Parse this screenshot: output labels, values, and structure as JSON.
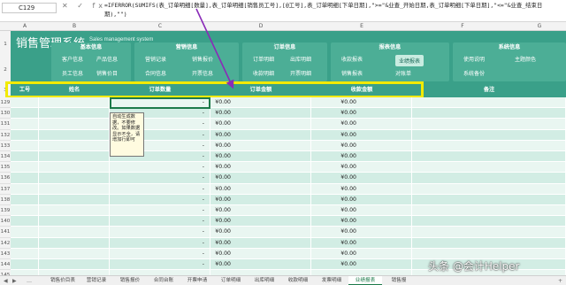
{
  "formula_bar": {
    "name_box": "C129",
    "icons": "✕ ✓ fx",
    "formula": "=IFERROR(SUMIFS(表_订单明细[数量],表_订单明细[销售员工号],[@工号],表_订单明细[下单日期],\">=\"&业查_开始日期,表_订单明细[下单日期],\"<=\"&业查_结束日期),\"\")"
  },
  "columns": [
    "A",
    "B",
    "C",
    "D",
    "E",
    "F",
    "G",
    "H"
  ],
  "banner": {
    "title": "销售管理系统",
    "subtitle": "Sales management system",
    "groups": [
      {
        "title": "基本信息",
        "buttons": [
          "客户信息",
          "产品信息",
          "员工信息",
          "销售价目"
        ]
      },
      {
        "title": "营销信息",
        "buttons": [
          "营销记录",
          "销售报价",
          "合同信息",
          "开票信息"
        ]
      },
      {
        "title": "订单信息",
        "buttons": [
          "订单明细",
          "出库明细",
          "收款明细",
          "开票明细"
        ]
      },
      {
        "title": "报表信息",
        "buttons": [
          "收款报表",
          "业绩报表",
          "销售报表",
          "对账单"
        ]
      },
      {
        "title": "系统信息",
        "buttons": [
          "使用说明",
          "主题颜色",
          "系统备份"
        ]
      }
    ]
  },
  "row_numbers_top": [
    "1",
    "2"
  ],
  "table_header": {
    "row": "3",
    "id": "工号",
    "name": "姓名",
    "qty": "订单数量",
    "amount": "订单金额",
    "received": "收款金额",
    "note": "备注"
  },
  "rows": [
    {
      "n": "129",
      "qty": "-",
      "amount": "¥0.00",
      "received": "¥0.00"
    },
    {
      "n": "130",
      "qty": "-",
      "amount": "¥0.00",
      "received": "¥0.00"
    },
    {
      "n": "131",
      "qty": "-",
      "amount": "¥0.00",
      "received": "¥0.00"
    },
    {
      "n": "132",
      "qty": "-",
      "amount": "¥0.00",
      "received": "¥0.00"
    },
    {
      "n": "133",
      "qty": "-",
      "amount": "¥0.00",
      "received": "¥0.00"
    },
    {
      "n": "134",
      "qty": "-",
      "amount": "¥0.00",
      "received": "¥0.00"
    },
    {
      "n": "135",
      "qty": "-",
      "amount": "¥0.00",
      "received": "¥0.00"
    },
    {
      "n": "136",
      "qty": "-",
      "amount": "¥0.00",
      "received": "¥0.00"
    },
    {
      "n": "137",
      "qty": "-",
      "amount": "¥0.00",
      "received": "¥0.00"
    },
    {
      "n": "138",
      "qty": "-",
      "amount": "¥0.00",
      "received": "¥0.00"
    },
    {
      "n": "139",
      "qty": "-",
      "amount": "¥0.00",
      "received": "¥0.00"
    },
    {
      "n": "140",
      "qty": "-",
      "amount": "¥0.00",
      "received": "¥0.00"
    },
    {
      "n": "141",
      "qty": "-",
      "amount": "¥0.00",
      "received": "¥0.00"
    },
    {
      "n": "142",
      "qty": "-",
      "amount": "¥0.00",
      "received": "¥0.00"
    },
    {
      "n": "143",
      "qty": "-",
      "amount": "¥0.00",
      "received": "¥0.00"
    },
    {
      "n": "144",
      "qty": "-",
      "amount": "¥0.00",
      "received": "¥0.00"
    },
    {
      "n": "145",
      "qty": "",
      "amount": "",
      "received": ""
    }
  ],
  "comment": "自动生成数据，不要修改。如果数据显示不全，请增加行即可",
  "watermark": "头条 @会计Helper",
  "tabs": [
    "销售价目表",
    "营销记录",
    "销售报价",
    "合同台账",
    "开票申请",
    "订单明细",
    "出库明细",
    "收款明细",
    "发票明细",
    "业绩报表",
    "销售报"
  ],
  "active_tab": "业绩报表",
  "colors": {
    "banner": "#3aa089",
    "row_light": "#e9f6f1",
    "row_dark": "#d2ede4",
    "highlight": "#f2ea00",
    "arrow": "#8a2bb8"
  }
}
